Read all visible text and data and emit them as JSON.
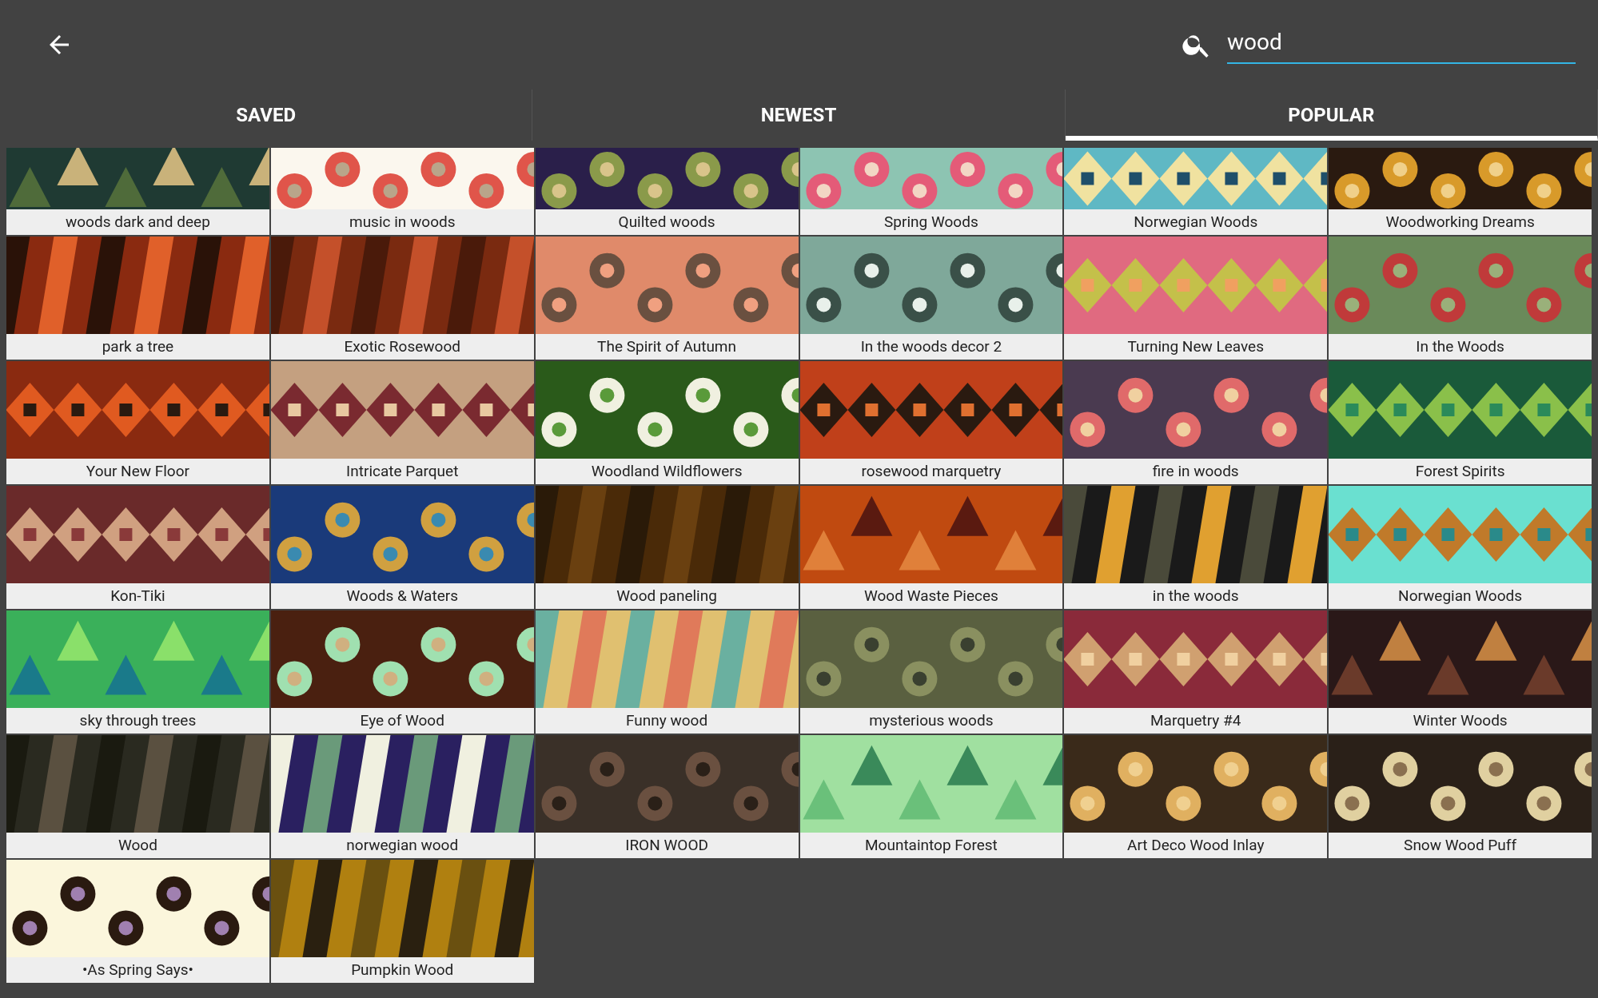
{
  "search": {
    "value": "wood"
  },
  "tabs": [
    {
      "label": "SAVED",
      "selected": false
    },
    {
      "label": "NEWEST",
      "selected": false
    },
    {
      "label": "POPULAR",
      "selected": true
    }
  ],
  "patterns": [
    {
      "title": "woods dark and deep"
    },
    {
      "title": "music in woods"
    },
    {
      "title": "Quilted woods"
    },
    {
      "title": "Spring Woods"
    },
    {
      "title": "Norwegian Woods"
    },
    {
      "title": "Woodworking Dreams"
    },
    {
      "title": "park a tree"
    },
    {
      "title": "Exotic Rosewood"
    },
    {
      "title": "The Spirit of Autumn"
    },
    {
      "title": "In the woods decor 2"
    },
    {
      "title": "Turning New Leaves"
    },
    {
      "title": "In the Woods"
    },
    {
      "title": "Your New Floor"
    },
    {
      "title": "Intricate Parquet"
    },
    {
      "title": "Woodland Wildflowers"
    },
    {
      "title": "rosewood marquetry"
    },
    {
      "title": "fire in woods"
    },
    {
      "title": "Forest Spirits"
    },
    {
      "title": "Kon-Tiki"
    },
    {
      "title": "Woods & Waters"
    },
    {
      "title": "Wood paneling"
    },
    {
      "title": "Wood Waste Pieces"
    },
    {
      "title": "in the woods"
    },
    {
      "title": "Norwegian Woods"
    },
    {
      "title": "sky through trees"
    },
    {
      "title": "Eye of Wood"
    },
    {
      "title": "Funny wood"
    },
    {
      "title": "mysterious woods"
    },
    {
      "title": "Marquetry #4"
    },
    {
      "title": "Winter Woods"
    },
    {
      "title": "Wood"
    },
    {
      "title": "norwegian wood"
    },
    {
      "title": "IRON WOOD"
    },
    {
      "title": "Mountaintop Forest"
    },
    {
      "title": "Art Deco Wood Inlay"
    },
    {
      "title": "Snow Wood Puff"
    },
    {
      "title": "•As Spring Says•"
    },
    {
      "title": "Pumpkin Wood"
    }
  ]
}
